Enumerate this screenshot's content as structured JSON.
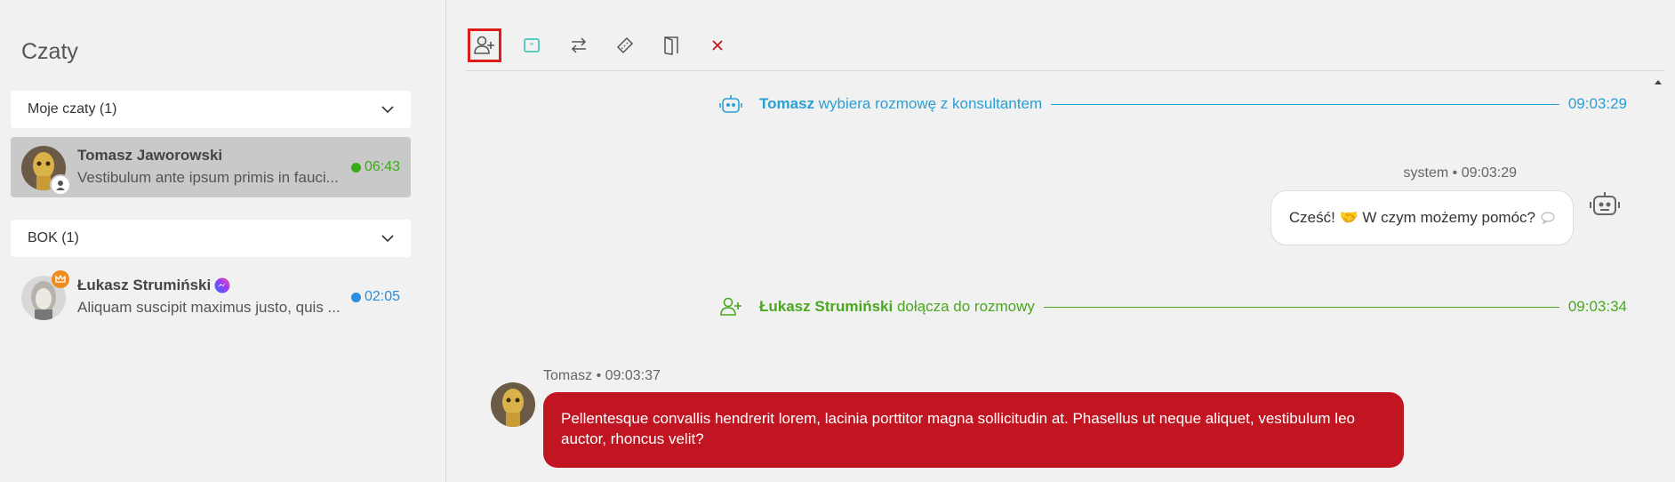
{
  "sidebar": {
    "title": "Czaty",
    "groups": [
      {
        "label": "Moje czaty (1)"
      },
      {
        "label": "BOK (1)"
      }
    ],
    "chats": [
      {
        "name": "Tomasz Jaworowski",
        "preview": "Vestibulum ante ipsum primis in fauci...",
        "time": "06:43",
        "status_color": "#3aaa1a",
        "active": true
      },
      {
        "name": "Łukasz Strumiński",
        "preview": "Aliquam suscipit maximus justo, quis ...",
        "time": "02:05",
        "status_color": "#2a8fe0",
        "channel_icon": "messenger-icon"
      }
    ]
  },
  "toolbar": {
    "items": [
      {
        "icon": "add-user-icon",
        "selected": true
      },
      {
        "icon": "quote-icon"
      },
      {
        "icon": "transfer-icon"
      },
      {
        "icon": "ticket-icon"
      },
      {
        "icon": "door-exit-icon"
      },
      {
        "icon": "close-icon"
      }
    ]
  },
  "conversation": {
    "event1": {
      "actor": "Tomasz",
      "text": "wybiera rozmowę z konsultantem",
      "time": "09:03:29",
      "color": "#2a9fd6",
      "icon": "robot-icon"
    },
    "system_message": {
      "meta": "system • 09:03:29",
      "text": "Cześć! 🤝 W czym możemy pomóc?",
      "icon": "robot-icon"
    },
    "event2": {
      "actor": "Łukasz Strumiński",
      "text": "dołącza do rozmowy",
      "time": "09:03:34",
      "color": "#4aa81e",
      "icon": "add-user-icon"
    },
    "user_message": {
      "meta": "Tomasz • 09:03:37",
      "text": "Pellentesque convallis hendrerit lorem, lacinia porttitor magna sollicitudin at. Phasellus ut neque aliquet, vestibulum leo auctor, rhoncus velit?",
      "color": "#c21522"
    }
  }
}
